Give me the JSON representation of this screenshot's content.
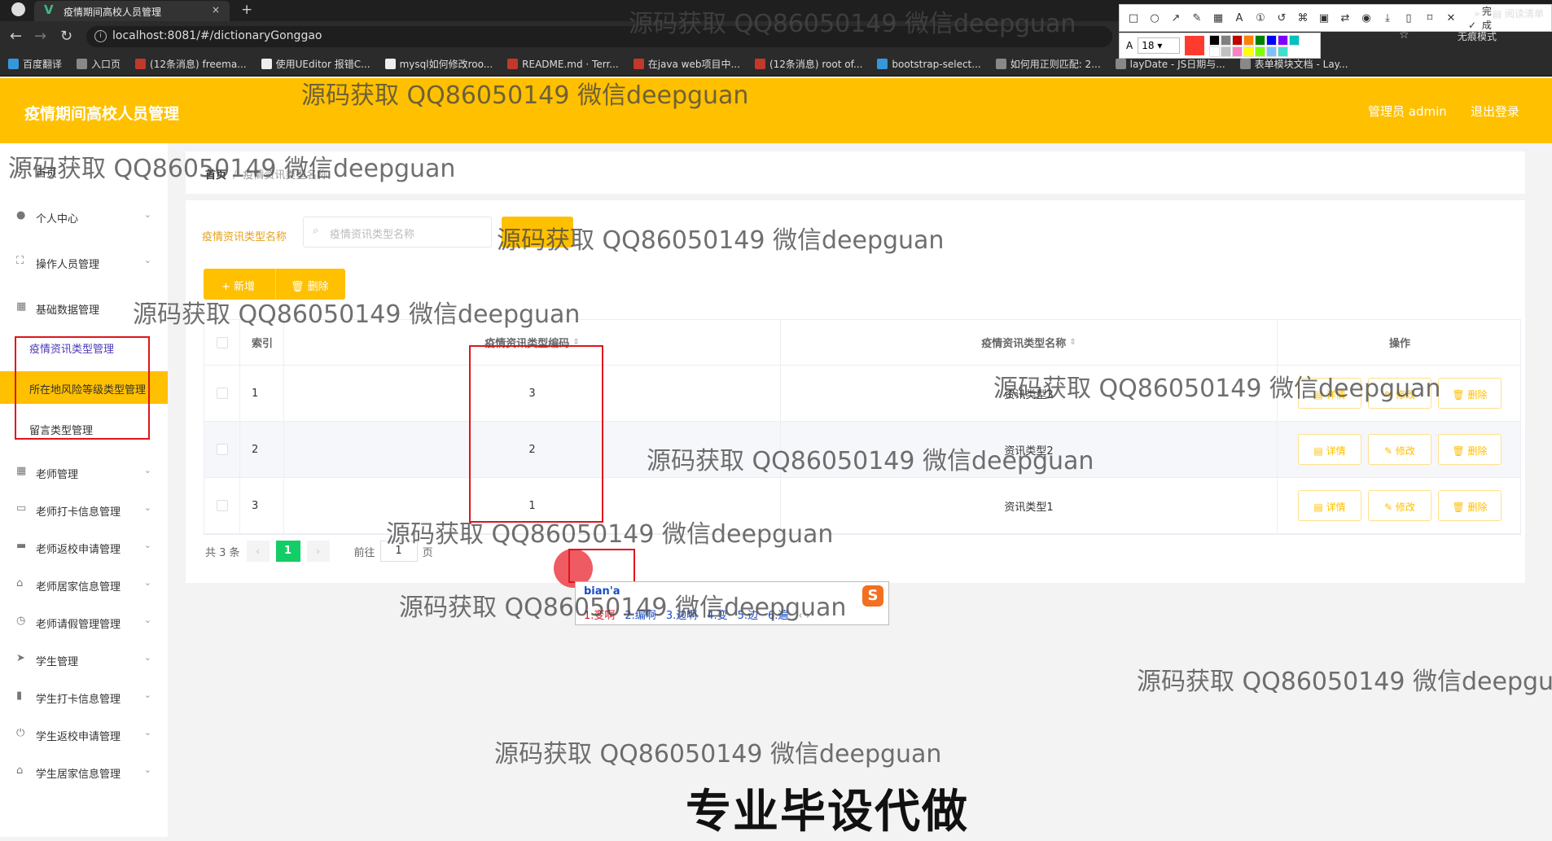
{
  "browser": {
    "tab_title": "疫情期间高校人员管理",
    "new_tab_symbol": "+",
    "close_symbol": "×",
    "url": "localhost:8081/#/dictionaryGonggao",
    "incognito_label": "无痕模式",
    "bookmarks": [
      "百度翻译",
      "入口页",
      "(12条消息) freema...",
      "使用UEditor 报错C...",
      "mysql如何修改roo...",
      "README.md · Terr...",
      "在java web项目中...",
      "(12条消息) root of...",
      "bootstrap-select...",
      "如何用正则匹配: 2...",
      "layDate - JS日期与...",
      "表单模块文档 - Lay..."
    ],
    "bookmarks_more": "»",
    "reading_list": "阅读清单"
  },
  "snip_toolbar": {
    "done_label": "完成",
    "font_size": "18",
    "colors": [
      "#ff3b30",
      "#000000",
      "#808080",
      "#c00000",
      "#ff8000",
      "#008000",
      "#0000ff",
      "#8000ff",
      "#00c0c0",
      "#ffffff",
      "#c0c0c0",
      "#ff80c0",
      "#ffff00",
      "#80ff00",
      "#80c0ff",
      "#40e0d0"
    ]
  },
  "app": {
    "title": "疫情期间高校人员管理",
    "user": "管理员 admin",
    "logout": "退出登录",
    "accent_color": "#ffc000"
  },
  "sidebar": {
    "home": "首页",
    "items": [
      {
        "label": "个人中心",
        "icon": "user-icon"
      },
      {
        "label": "操作人员管理",
        "icon": "frame-icon"
      },
      {
        "label": "基础数据管理",
        "icon": "grid-icon"
      }
    ],
    "sub_items": [
      "疫情资讯类型管理",
      "所在地风险等级类型管理",
      "留言类型管理"
    ],
    "more_items": [
      {
        "label": "老师管理",
        "icon": "grid-icon"
      },
      {
        "label": "老师打卡信息管理",
        "icon": "chat-icon"
      },
      {
        "label": "老师返校申请管理",
        "icon": "briefcase-icon"
      },
      {
        "label": "老师居家信息管理",
        "icon": "home-icon"
      },
      {
        "label": "老师请假管理管理",
        "icon": "clock-icon"
      },
      {
        "label": "学生管理",
        "icon": "send-icon"
      },
      {
        "label": "学生打卡信息管理",
        "icon": "chart-icon"
      },
      {
        "label": "学生返校申请管理",
        "icon": "power-icon"
      },
      {
        "label": "学生居家信息管理",
        "icon": "home-icon"
      }
    ]
  },
  "breadcrumb": {
    "home": "首页",
    "separator": "/",
    "current": "疫情资讯类型名称"
  },
  "search": {
    "label": "疫情资讯类型名称",
    "placeholder": "疫情资讯类型名称"
  },
  "actions": {
    "add": "+ 新增",
    "delete": "删除"
  },
  "table": {
    "columns": [
      "索引",
      "疫情资讯类型编码",
      "疫情资讯类型名称",
      "操作"
    ],
    "rows": [
      {
        "index": "1",
        "code": "3",
        "name": "资讯类型3"
      },
      {
        "index": "2",
        "code": "2",
        "name": "资讯类型2"
      },
      {
        "index": "3",
        "code": "1",
        "name": "资讯类型1"
      }
    ],
    "ops": {
      "detail": "详情",
      "edit": "修改",
      "delete": "删除"
    }
  },
  "pagination": {
    "total": "共 3 条",
    "current": "1",
    "goto_prefix": "前往",
    "goto_value": "1",
    "goto_suffix": "页",
    "prev": "‹",
    "next": "›"
  },
  "ime": {
    "pinyin": "bian'a",
    "candidates": [
      "1.变啊",
      "2.编啊",
      "3.边啊",
      "4.变",
      "5.边",
      "6.遍"
    ],
    "logo": "S"
  },
  "watermarks": [
    "源码获取 QQ86050149 微信deepguan"
  ],
  "promo": "专业毕设代做"
}
